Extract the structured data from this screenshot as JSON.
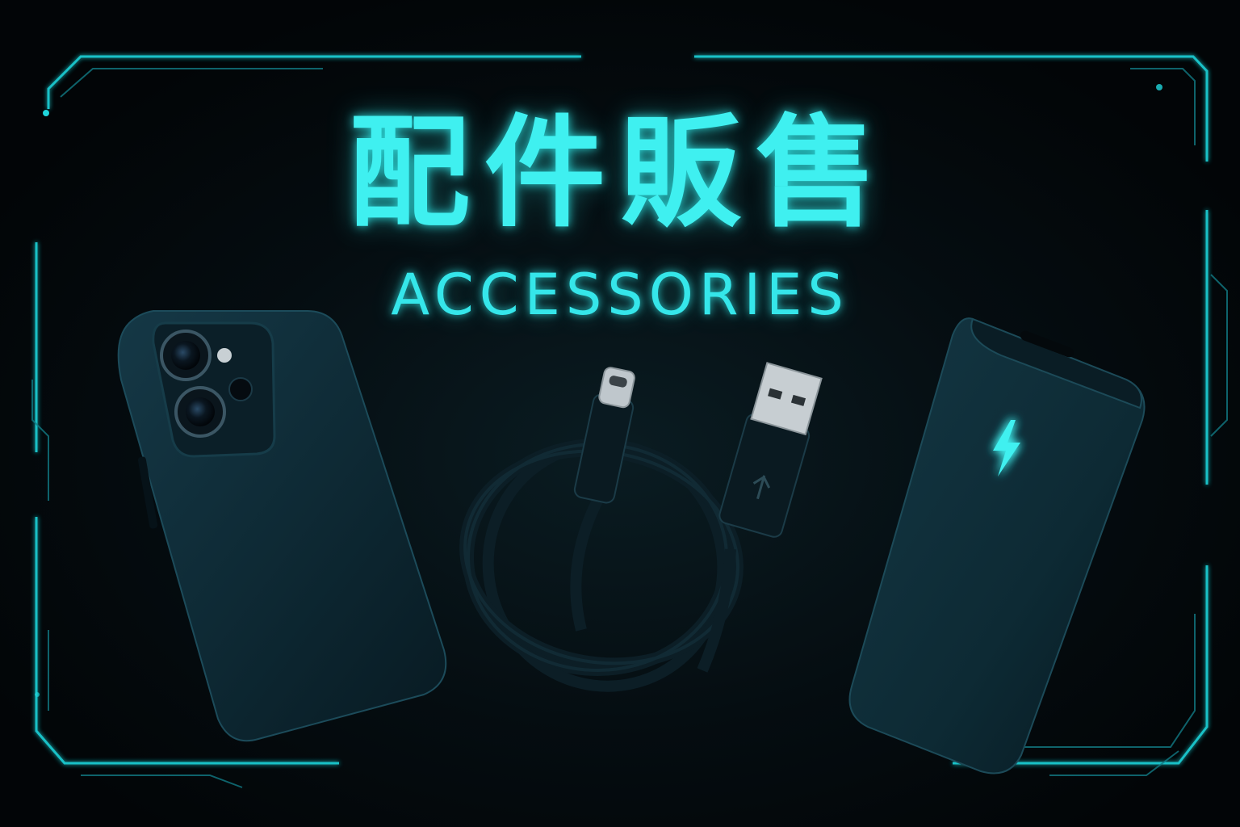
{
  "title": {
    "zh": "配件販售",
    "en": "ACCESSORIES"
  },
  "products": [
    {
      "name": "phone-case",
      "icon": "phone-case-icon"
    },
    {
      "name": "usb-cable",
      "icon": "usb-c-to-usb-a-cable-icon"
    },
    {
      "name": "power-bank",
      "icon": "power-bank-icon",
      "badge_icon": "lightning-bolt-icon"
    }
  ],
  "colors": {
    "accent": "#3ff0f0",
    "background": "#03080b",
    "product_body": "#0f2a35"
  }
}
